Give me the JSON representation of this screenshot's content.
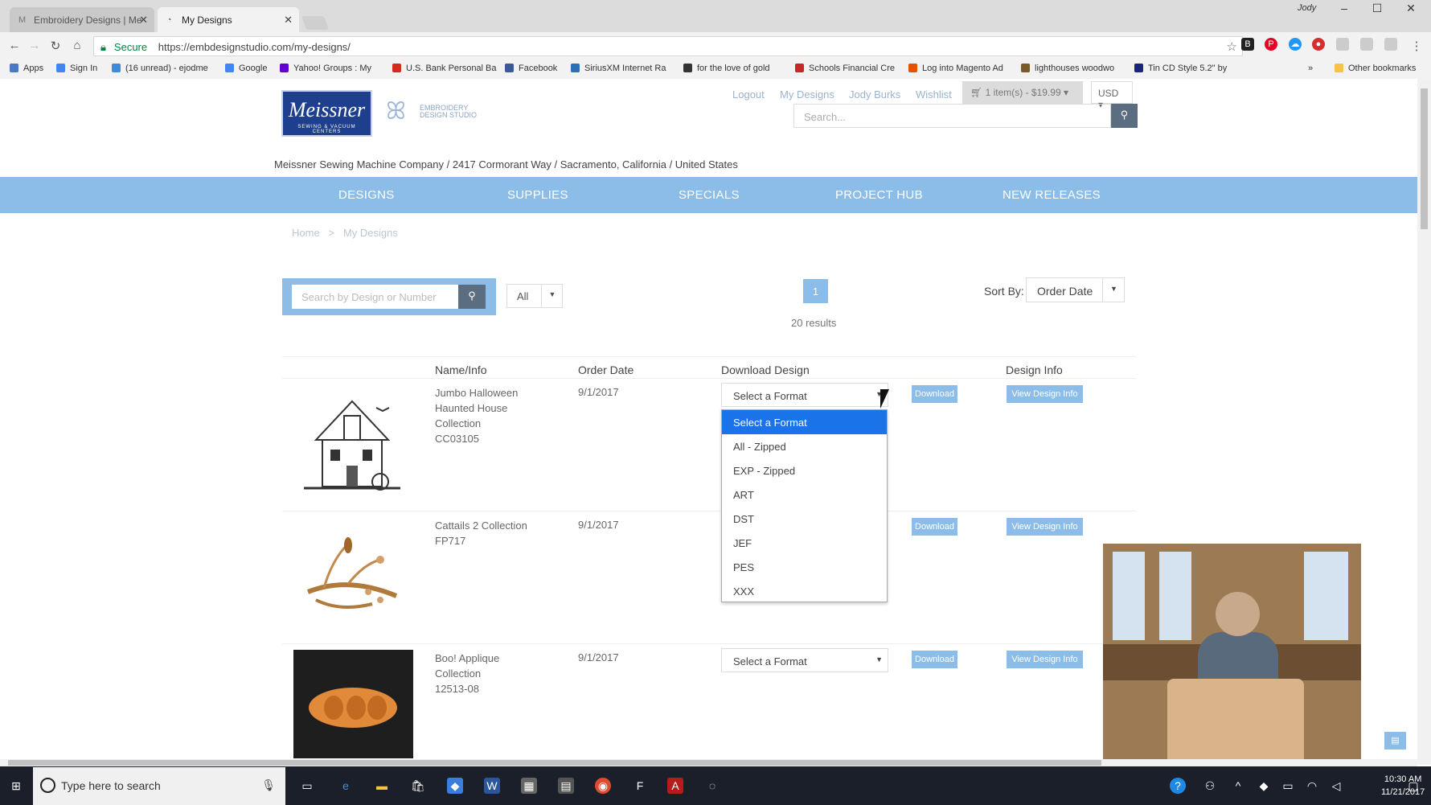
{
  "browser": {
    "tabs": [
      {
        "label": "Embroidery Designs | Me"
      },
      {
        "label": "My Designs"
      }
    ],
    "user_name": "Jody",
    "address": {
      "secure_label": "Secure",
      "url": "https://embdesignstudio.com/my-designs/"
    },
    "bookmarks": [
      {
        "label": "Apps",
        "color": "#4a78c2"
      },
      {
        "label": "Sign In",
        "color": "#4285f4"
      },
      {
        "label": "(16 unread) - ejodme",
        "color": "#3d8be0"
      },
      {
        "label": "Google",
        "color": "#4285f4"
      },
      {
        "label": "Yahoo! Groups : My",
        "color": "#5f01d1"
      },
      {
        "label": "U.S. Bank Personal Ba",
        "color": "#d52b1e"
      },
      {
        "label": "Facebook",
        "color": "#3b5998"
      },
      {
        "label": "SiriusXM Internet Ra",
        "color": "#2a6fb8"
      },
      {
        "label": "for the love of gold",
        "color": "#333333"
      },
      {
        "label": "Schools Financial Cre",
        "color": "#c62828"
      },
      {
        "label": "Log into Magento Ad",
        "color": "#e65100"
      },
      {
        "label": "lighthouses woodwo",
        "color": "#7a5a2a"
      },
      {
        "label": "Tin CD Style 5.2\" by",
        "color": "#1a237e"
      }
    ],
    "other_bookmarks": "Other bookmarks"
  },
  "site": {
    "logo_text": "Meissner",
    "logo_subtext": "SEWING & VACUUM CENTERS",
    "logo2_line1": "EMBROIDERY",
    "logo2_line2": "DESIGN STUDIO",
    "top_links": {
      "logout": "Logout",
      "my_designs": "My Designs",
      "account_name": "Jody Burks",
      "wishlist": "Wishlist"
    },
    "cart_label": "1 item(s) - $19.99",
    "currency": "USD",
    "search_placeholder": "Search...",
    "company_address": "Meissner Sewing Machine Company / 2417 Cormorant Way / Sacramento, California / United States",
    "nav": [
      "DESIGNS",
      "SUPPLIES",
      "SPECIALS",
      "PROJECT HUB",
      "NEW RELEASES"
    ],
    "breadcrumb": {
      "home": "Home",
      "separator": ">",
      "current": "My Designs"
    }
  },
  "filters": {
    "search_placeholder": "Search by Design or Number",
    "category_value": "All",
    "page_number": "1",
    "results_text": "20 results",
    "sort_label": "Sort By:",
    "sort_value": "Order Date"
  },
  "table": {
    "headers": [
      "Name/Info",
      "Order Date",
      "Download Design",
      "Design Info"
    ],
    "rows": [
      {
        "name_lines": [
          "Jumbo Halloween",
          "Haunted House",
          "Collection",
          "CC03105"
        ],
        "order_date": "9/1/2017",
        "format": "Select a Format",
        "download": "Download",
        "view": "View Design Info"
      },
      {
        "name_lines": [
          "Cattails 2 Collection",
          "FP717"
        ],
        "order_date": "9/1/2017",
        "format": "Select a Format",
        "download": "Download",
        "view": "View Design Info"
      },
      {
        "name_lines": [
          "Boo! Applique",
          "Collection",
          "12513-08"
        ],
        "order_date": "9/1/2017",
        "format": "Select a Format",
        "download": "Download",
        "view": "View Design Info"
      }
    ]
  },
  "format_options": [
    "Select a Format",
    "All - Zipped",
    "EXP - Zipped",
    "ART",
    "DST",
    "JEF",
    "PES",
    "XXX"
  ],
  "taskbar": {
    "search_text": "Type here to search",
    "time": "10:30 AM",
    "date": "11/21/2017"
  },
  "colors": {
    "accent": "#8cbde8",
    "dark_button": "#5b6d80",
    "selected_option": "#1a73e8",
    "logo_blue": "#1d3f8e"
  }
}
